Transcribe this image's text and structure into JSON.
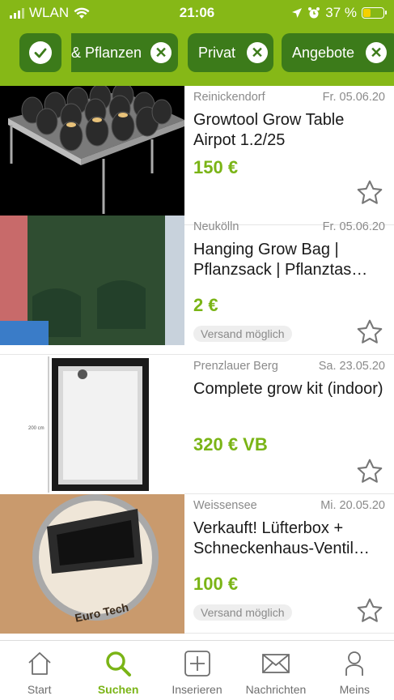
{
  "status_bar": {
    "carrier": "WLAN",
    "time": "21:06",
    "battery": "37 %"
  },
  "filters": [
    {
      "label": ""
    },
    {
      "label": "& Pflanzen"
    },
    {
      "label": "Privat"
    },
    {
      "label": "Angebote"
    }
  ],
  "listings": [
    {
      "location": "Reinickendorf",
      "date": "Fr. 05.06.20",
      "title": "Growtool Grow Table Airpot 1.2/25",
      "price": "150 €",
      "shipping": ""
    },
    {
      "location": "Neukölln",
      "date": "Fr. 05.06.20",
      "title": "Hanging Grow Bag | Pflanzsack | Pflanztas…",
      "price": "2 €",
      "shipping": "Versand möglich"
    },
    {
      "location": "Prenzlauer Berg",
      "date": "Sa. 23.05.20",
      "title": "Complete grow kit (indoor)",
      "price": "320 € VB",
      "shipping": "",
      "image_caption": "200 cm"
    },
    {
      "location": "Weissensee",
      "date": "Mi. 20.05.20",
      "title": "Verkauft! Lüfterbox + Schneckenhaus-Ventil…",
      "price": "100 €",
      "shipping": "Versand möglich",
      "image_caption": "Euro Tech"
    }
  ],
  "tabs": [
    {
      "label": "Start",
      "icon": "home-icon"
    },
    {
      "label": "Suchen",
      "icon": "search-icon"
    },
    {
      "label": "Inserieren",
      "icon": "plus-icon"
    },
    {
      "label": "Nachrichten",
      "icon": "mail-icon"
    },
    {
      "label": "Meins",
      "icon": "person-icon"
    }
  ],
  "colors": {
    "brand": "#86b817",
    "chip": "#3c7b1a",
    "price": "#7ab416"
  }
}
